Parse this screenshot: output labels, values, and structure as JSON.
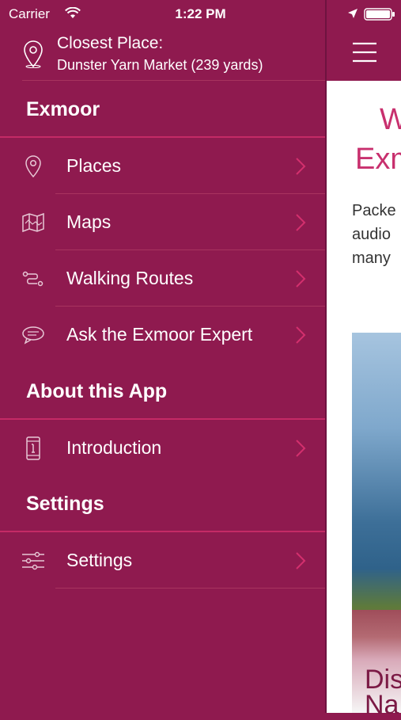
{
  "status_bar": {
    "carrier": "Carrier",
    "time": "1:22 PM"
  },
  "closest_place": {
    "title": "Closest Place:",
    "value": "Dunster Yarn Market (239 yards)"
  },
  "sections": [
    {
      "title": "Exmoor"
    },
    {
      "title": "About this App"
    },
    {
      "title": "Settings"
    }
  ],
  "menu": {
    "places": {
      "label": "Places",
      "icon": "map-pin-icon"
    },
    "maps": {
      "label": "Maps",
      "icon": "folded-map-icon"
    },
    "walking_routes": {
      "label": "Walking Routes",
      "icon": "route-icon"
    },
    "ask_expert": {
      "label": "Ask the Exmoor Expert",
      "icon": "speech-bubble-icon"
    },
    "introduction": {
      "label": "Introduction",
      "icon": "info-phone-icon"
    },
    "settings": {
      "label": "Settings",
      "icon": "sliders-icon"
    }
  },
  "content": {
    "heading_line1": "W",
    "heading_line2": "Exm",
    "para_line1": "Packe",
    "para_line2": "audio",
    "para_line3": "many",
    "caption_line1": "Dis",
    "caption_line2": "Na"
  },
  "colors": {
    "drawer_bg": "#8f1a4f",
    "accent": "#c8306e",
    "separator": "#c42a66"
  }
}
